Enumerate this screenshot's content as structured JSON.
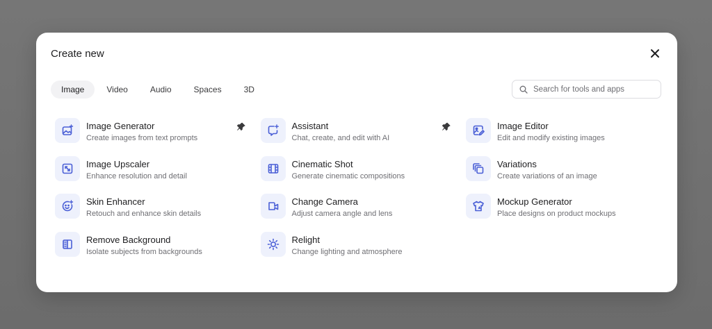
{
  "modal": {
    "title": "Create new",
    "close_icon": "close-icon"
  },
  "tabs": [
    {
      "label": "Image",
      "active": true
    },
    {
      "label": "Video",
      "active": false
    },
    {
      "label": "Audio",
      "active": false
    },
    {
      "label": "Spaces",
      "active": false
    },
    {
      "label": "3D",
      "active": false
    }
  ],
  "search": {
    "placeholder": "Search for tools and apps",
    "value": "",
    "icon": "search-icon"
  },
  "colors": {
    "accent": "#4a5fd6",
    "icon_bg": "#eef1fc",
    "active_tab_bg": "#f2f2f4"
  },
  "tools": [
    {
      "name": "Image Generator",
      "desc": "Create images from text prompts",
      "icon": "image-sparkle-icon",
      "pinned": true
    },
    {
      "name": "Assistant",
      "desc": "Chat, create, and edit with AI",
      "icon": "chat-sparkle-icon",
      "pinned": true
    },
    {
      "name": "Image Editor",
      "desc": "Edit and modify existing images",
      "icon": "image-edit-icon",
      "pinned": false
    },
    {
      "name": "Image Upscaler",
      "desc": "Enhance resolution and detail",
      "icon": "upscale-icon",
      "pinned": false
    },
    {
      "name": "Cinematic Shot",
      "desc": "Generate cinematic compositions",
      "icon": "film-icon",
      "pinned": false
    },
    {
      "name": "Variations",
      "desc": "Create variations of an image",
      "icon": "copies-icon",
      "pinned": false
    },
    {
      "name": "Skin Enhancer",
      "desc": "Retouch and enhance skin details",
      "icon": "face-sparkle-icon",
      "pinned": false
    },
    {
      "name": "Change Camera",
      "desc": "Adjust camera angle and lens",
      "icon": "video-camera-icon",
      "pinned": false
    },
    {
      "name": "Mockup Generator",
      "desc": "Place designs on product mockups",
      "icon": "shirt-icon",
      "pinned": false
    },
    {
      "name": "Remove Background",
      "desc": "Isolate subjects from backgrounds",
      "icon": "remove-bg-icon",
      "pinned": false
    },
    {
      "name": "Relight",
      "desc": "Change lighting and atmosphere",
      "icon": "sun-icon",
      "pinned": false
    }
  ]
}
